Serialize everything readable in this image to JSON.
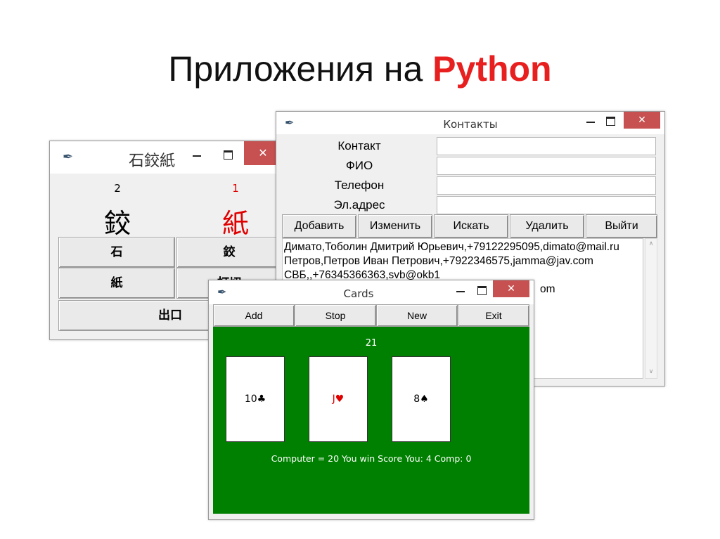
{
  "slide": {
    "title_main": "Приложения на",
    "title_accent": "Python"
  },
  "rps_window": {
    "title": "石鉸紙",
    "score_left": "2",
    "score_right": "1",
    "choice_left": "鉸",
    "choice_right": "紙",
    "buttons": [
      "石",
      "鉸",
      "紙",
      "打切"
    ],
    "exit_label": "出口"
  },
  "contacts_window": {
    "title": "Контакты",
    "fields": [
      {
        "label": "Контакт",
        "value": ""
      },
      {
        "label": "ФИО",
        "value": ""
      },
      {
        "label": "Телефон",
        "value": ""
      },
      {
        "label": "Эл.адрес",
        "value": ""
      }
    ],
    "buttons": [
      "Добавить",
      "Изменить",
      "Искать",
      "Удалить",
      "Выйти"
    ],
    "records": [
      "Димато,Тоболин Дмитрий Юрьевич,+79122295095,dimato@mail.ru",
      "Петров,Петров Иван Петрович,+7922346575,jamma@jav.com",
      "СВБ,,+76345366363,svb@okb1",
      "om"
    ]
  },
  "cards_window": {
    "title": "Cards",
    "buttons": [
      "Add",
      "Stop",
      "New",
      "Exit"
    ],
    "score": "21",
    "cards": [
      {
        "label": "10♣",
        "color": "#000000"
      },
      {
        "label": "J♥",
        "color": "#e00000"
      },
      {
        "label": "8♠",
        "color": "#000000"
      }
    ],
    "status": "Computer = 20 You win Score You: 4 Comp: 0",
    "table_color": "#008000"
  },
  "icons": {
    "app": "feather-icon",
    "close": "close-icon",
    "minimize": "minimize-icon",
    "maximize": "maximize-icon"
  },
  "colors": {
    "accent": "#e81f1f",
    "close_button": "#c75050",
    "red_text": "#e00000"
  }
}
